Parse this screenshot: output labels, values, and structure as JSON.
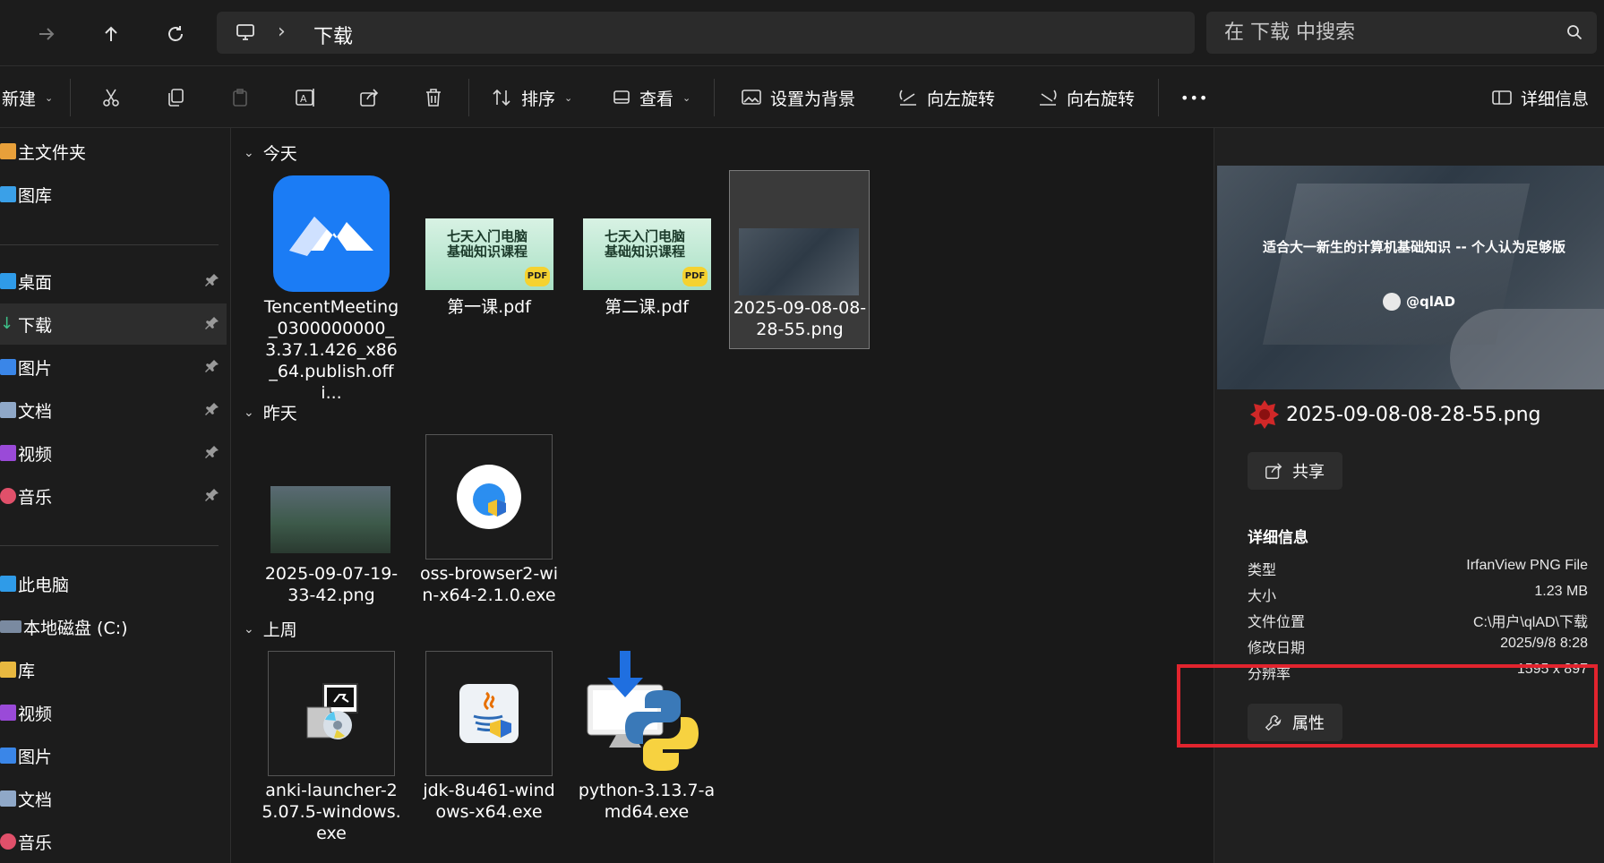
{
  "address_bar": {
    "back_icon": "arrow-left-icon",
    "forward_icon": "arrow-right-icon",
    "up_icon": "arrow-up-icon",
    "refresh_icon": "refresh-icon",
    "pc_icon": "monitor-icon",
    "separator": "›",
    "crumb": "下载",
    "search_placeholder": "在 下载 中搜索"
  },
  "command_bar": {
    "new": "新建",
    "sort": "排序",
    "view": "查看",
    "set_background": "设置为背景",
    "rotate_left": "向左旋转",
    "rotate_right": "向右旋转",
    "more": "•••",
    "details": "详细信息"
  },
  "sidebar": {
    "items": [
      {
        "label": "主文件夹",
        "icon": "home-icon"
      },
      {
        "label": "图库",
        "icon": "gallery-icon"
      },
      {
        "label": "桌面",
        "icon": "desktop-icon"
      },
      {
        "label": "下载",
        "icon": "download-icon"
      },
      {
        "label": "图片",
        "icon": "pictures-icon"
      },
      {
        "label": "文档",
        "icon": "documents-icon"
      },
      {
        "label": "视频",
        "icon": "videos-icon"
      },
      {
        "label": "音乐",
        "icon": "music-icon"
      },
      {
        "label": "此电脑",
        "icon": "pc-icon"
      },
      {
        "label": "本地磁盘 (C:)",
        "icon": "drive-icon"
      },
      {
        "label": "库",
        "icon": "library-icon"
      },
      {
        "label": "视频",
        "icon": "videos-icon"
      },
      {
        "label": "图片",
        "icon": "pictures-icon"
      },
      {
        "label": "文档",
        "icon": "documents-icon"
      },
      {
        "label": "音乐",
        "icon": "music-icon"
      }
    ]
  },
  "groups": [
    {
      "label": "今天",
      "files": [
        {
          "name": "TencentMeeting_0300000000_3.37.1.426_x86_64.publish.offi...",
          "icon": "tencent-meeting-icon"
        },
        {
          "name": "第一课.pdf",
          "icon": "pdf-thumbnail"
        },
        {
          "name": "第二课.pdf",
          "icon": "pdf-thumbnail"
        },
        {
          "name": "2025-09-08-08-28-55.png",
          "icon": "png-thumbnail"
        }
      ]
    },
    {
      "label": "昨天",
      "files": [
        {
          "name": "2025-09-07-19-33-42.png",
          "icon": "png-thumbnail"
        },
        {
          "name": "oss-browser2-win-x64-2.1.0.exe",
          "icon": "oss-browser-icon"
        }
      ]
    },
    {
      "label": "上周",
      "files": [
        {
          "name": "anki-launcher-25.07.5-windows.exe",
          "icon": "installer-icon"
        },
        {
          "name": "jdk-8u461-windows-x64.exe",
          "icon": "java-icon"
        },
        {
          "name": "python-3.13.7-amd64.exe",
          "icon": "python-installer-icon"
        }
      ]
    }
  ],
  "pdf_thumb": {
    "line1": "七天入门电脑",
    "line2": "基础知识课程",
    "badge": "PDF"
  },
  "details_pane": {
    "preview_text": "适合大一新生的计算机基础知识 -- 个人认为足够版",
    "preview_author": "@qlAD",
    "file_name": "2025-09-08-08-28-55.png",
    "share": "共享",
    "section": "详细信息",
    "rows": [
      {
        "key": "类型",
        "value": "IrfanView PNG File"
      },
      {
        "key": "大小",
        "value": "1.23 MB"
      },
      {
        "key": "文件位置",
        "value": "C:\\用户\\qlAD\\下载"
      },
      {
        "key": "修改日期",
        "value": "2025/9/8 8:28"
      },
      {
        "key": "分辨率",
        "value": "1595 x 897"
      }
    ],
    "properties": "属性"
  },
  "colors": {
    "accent": "#0a84ff",
    "highlight_box": "#e2242e",
    "background": "#191919"
  }
}
